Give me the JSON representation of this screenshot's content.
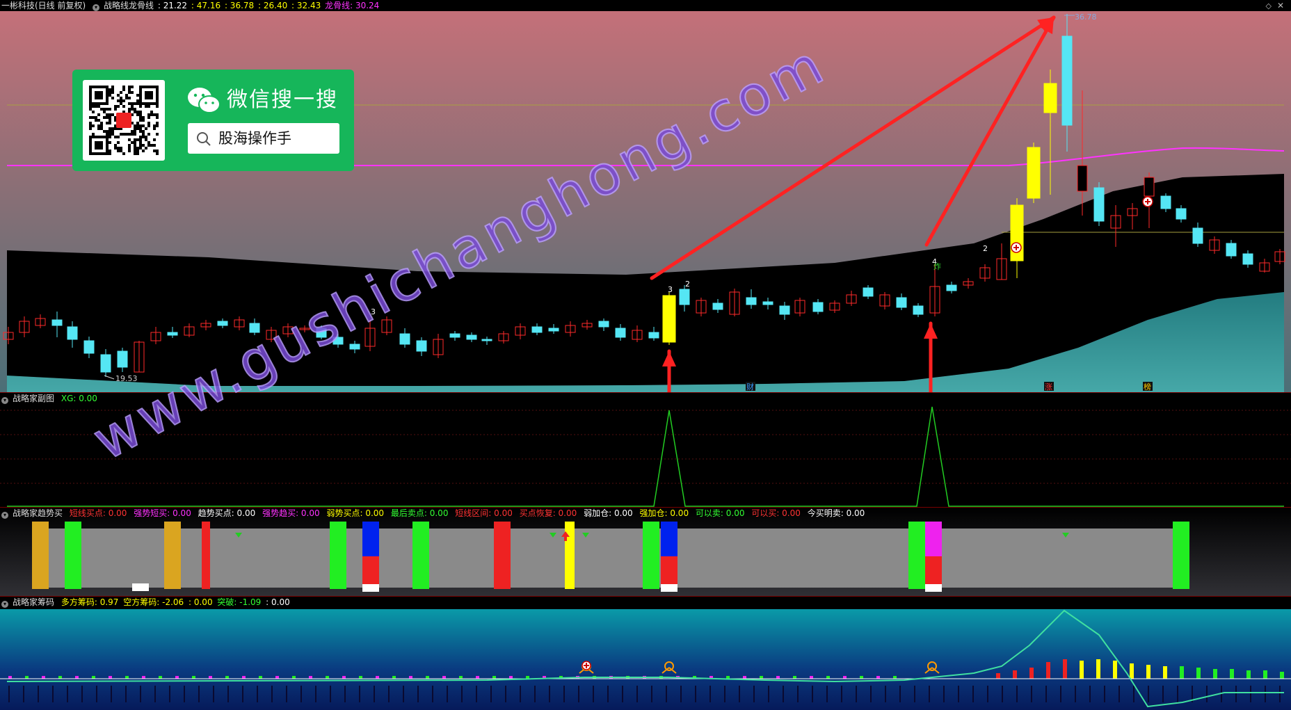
{
  "main_panel": {
    "title": "一彬科技(日线 前复权)",
    "indicator_name": "战略线龙骨线",
    "values": [
      {
        "text": ": 21.22",
        "color": "#ffffff"
      },
      {
        "text": ": 47.16",
        "color": "#ffff00"
      },
      {
        "text": ": 36.78",
        "color": "#ffff00"
      },
      {
        "text": ": 26.40",
        "color": "#ffff00"
      },
      {
        "text": ": 32.43",
        "color": "#ffff00"
      },
      {
        "text": "龙骨线: 30.24",
        "color": "#ff33ff"
      }
    ],
    "high_label": "36.78",
    "low_label": "19.53",
    "markers": [
      {
        "text": "财",
        "color": "#3399ff"
      },
      {
        "text": "涨",
        "color": "#ff3333"
      },
      {
        "text": "榜",
        "color": "#ffcc00"
      }
    ],
    "candle_numbers": [
      "3",
      "3",
      "2",
      "4",
      "2"
    ],
    "annotation": "炸",
    "colors": {
      "up": "#ff2a2a",
      "down": "#55e6f4",
      "signal": "#ffff00",
      "dragon_line": "#ff33ff",
      "arrow": "#ff2222"
    }
  },
  "wechat_box": {
    "title": "微信搜一搜",
    "search_text": "股海操作手"
  },
  "watermark": "www.gushichanghong.com",
  "sub_panel": {
    "name": "战略家副图",
    "value_label": "XG: 0.00",
    "colors": {
      "line": "#22cc22"
    }
  },
  "trend_panel": {
    "name": "战略家趋势买",
    "labels": [
      {
        "text": "短线买点: 0.00",
        "color": "#ff3333"
      },
      {
        "text": "强势短买: 0.00",
        "color": "#ff33ff"
      },
      {
        "text": "趋势买点: 0.00",
        "color": "#ffffff"
      },
      {
        "text": "强势趋买: 0.00",
        "color": "#ff33ff"
      },
      {
        "text": "弱势买点: 0.00",
        "color": "#ffff00"
      },
      {
        "text": "最后卖点: 0.00",
        "color": "#33ff33"
      },
      {
        "text": "短线区间: 0.00",
        "color": "#ff3333"
      },
      {
        "text": "买点恢复: 0.00",
        "color": "#ff3333"
      },
      {
        "text": "弱加仓: 0.00",
        "color": "#ffffff"
      },
      {
        "text": "强加仓: 0.00",
        "color": "#ffff00"
      },
      {
        "text": "可以卖: 0.00",
        "color": "#33ff33"
      },
      {
        "text": "可以买: 0.00",
        "color": "#ff3333"
      },
      {
        "text": "今买明卖: 0.00",
        "color": "#ffffff"
      }
    ]
  },
  "chip_panel": {
    "name": "战略家筹码",
    "labels": [
      {
        "text": "多方筹码: 0.97",
        "color": "#ffff00"
      },
      {
        "text": "空方筹码: -2.06",
        "color": "#ffff00"
      },
      {
        "text": ": 0.00",
        "color": "#ffff00"
      },
      {
        "text": "突破: -1.09",
        "color": "#33ff33"
      },
      {
        "text": ": 0.00",
        "color": "#ffffff"
      }
    ]
  }
}
